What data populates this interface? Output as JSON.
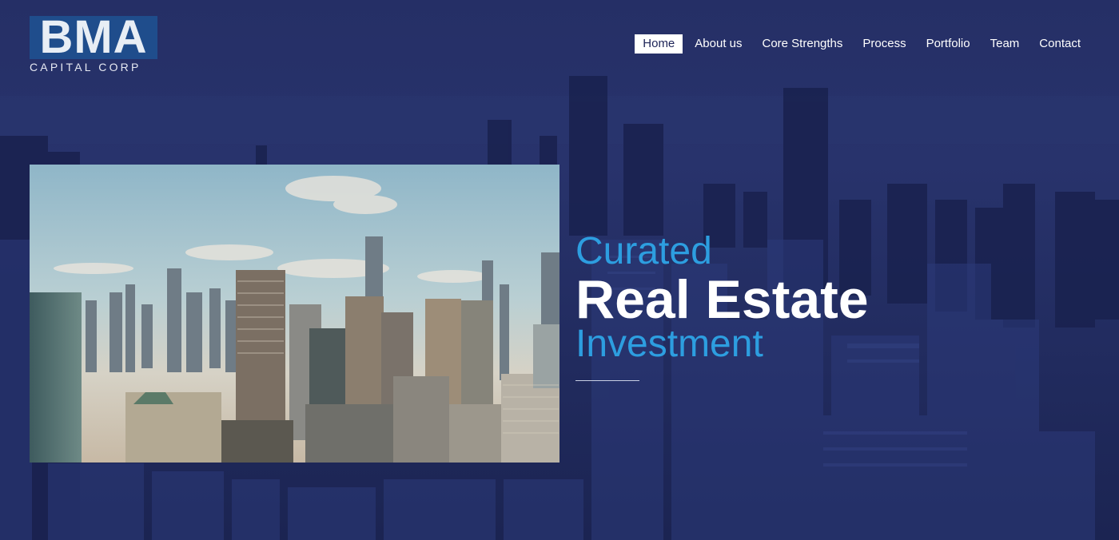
{
  "brand": {
    "logo_letters": "BMA",
    "logo_subtitle": "CAPITAL CORP",
    "logo_color": "#1f4d8c"
  },
  "nav": {
    "items": [
      {
        "label": "Home",
        "active": true
      },
      {
        "label": "About us",
        "active": false
      },
      {
        "label": "Core Strengths",
        "active": false
      },
      {
        "label": "Process",
        "active": false
      },
      {
        "label": "Portfolio",
        "active": false
      },
      {
        "label": "Team",
        "active": false
      },
      {
        "label": "Contact",
        "active": false
      }
    ]
  },
  "hero": {
    "line1": "Curated",
    "line2": "Real Estate",
    "line3": "Investment",
    "accent_color": "#2d9ee0",
    "background_color": "#1f2a5a"
  }
}
